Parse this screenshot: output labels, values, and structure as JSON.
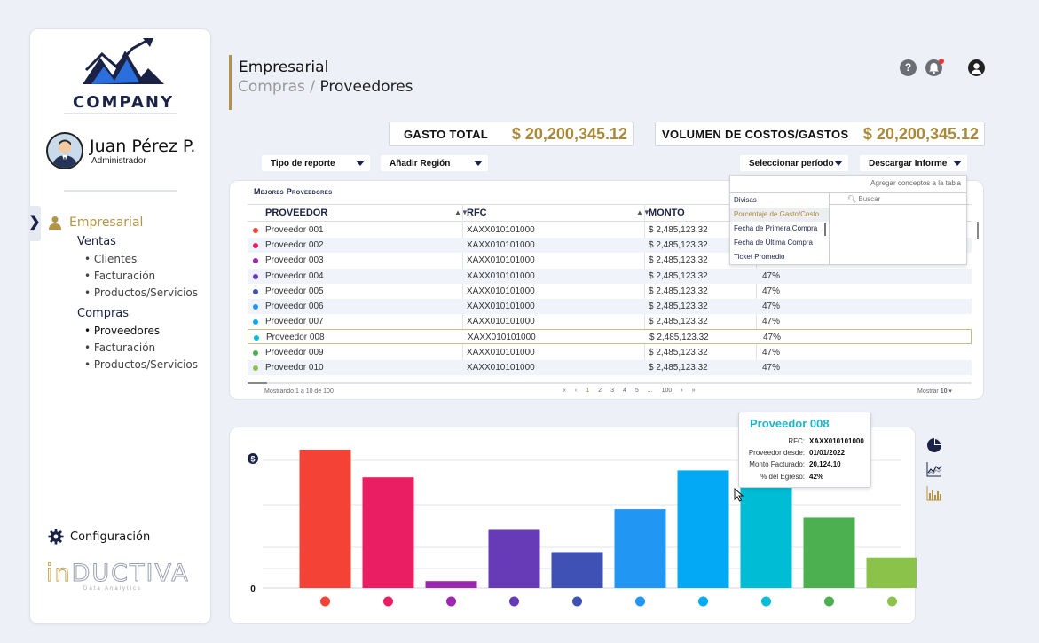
{
  "brand": {
    "company": "COMPANY",
    "footer_logo_in": "in",
    "footer_logo_rest": "DUCTIVA",
    "footer_logo_sub": "Data Analytics"
  },
  "user": {
    "name": "Juan Pérez P.",
    "role": "Administrador"
  },
  "nav": {
    "main": "Empresarial",
    "sections": [
      {
        "label": "Ventas",
        "items": [
          "Clientes",
          "Facturación",
          "Productos/Servicios"
        ]
      },
      {
        "label": "Compras",
        "items": [
          "Proveedores",
          "Facturación",
          "Productos/Servicios"
        ]
      }
    ],
    "config": "Configuración"
  },
  "header": {
    "title": "Empresarial",
    "breadcrumb_parent": "Compras",
    "breadcrumb_sep": " / ",
    "breadcrumb_current": "Proveedores",
    "help": "?"
  },
  "kpis": {
    "gasto_label": "GASTO TOTAL",
    "gasto_value": "$ 20,200,345.12",
    "volumen_label": "VOLUMEN DE COSTOS/GASTOS",
    "volumen_value": "$ 20,200,345.12"
  },
  "filters": {
    "tipo_reporte": "Tipo de reporte",
    "anadir_region": "Añadir Región",
    "seleccionar_periodo": "Seleccionar período",
    "descargar_informe": "Descargar Informe"
  },
  "table": {
    "title": "Mejores Proveedores",
    "columns": [
      "PROVEEDOR",
      "RFC",
      "MONTO"
    ],
    "rows": [
      {
        "name": "Proveedor 001",
        "rfc": "XAXX010101000",
        "monto": "$ 2,485,123.32",
        "pct": "",
        "color": "#f44336"
      },
      {
        "name": "Proveedor 002",
        "rfc": "XAXX010101000",
        "monto": "$ 2,485,123.32",
        "pct": "",
        "color": "#e91e63"
      },
      {
        "name": "Proveedor 003",
        "rfc": "XAXX010101000",
        "monto": "$ 2,485,123.32",
        "pct": "",
        "color": "#9c27b0"
      },
      {
        "name": "Proveedor 004",
        "rfc": "XAXX010101000",
        "monto": "$ 2,485,123.32",
        "pct": "47%",
        "color": "#673ab7"
      },
      {
        "name": "Proveedor 005",
        "rfc": "XAXX010101000",
        "monto": "$ 2,485,123.32",
        "pct": "47%",
        "color": "#3f51b5"
      },
      {
        "name": "Proveedor 006",
        "rfc": "XAXX010101000",
        "monto": "$ 2,485,123.32",
        "pct": "47%",
        "color": "#2196f3"
      },
      {
        "name": "Proveedor 007",
        "rfc": "XAXX010101000",
        "monto": "$ 2,485,123.32",
        "pct": "47%",
        "color": "#03a9f4"
      },
      {
        "name": "Proveedor 008",
        "rfc": "XAXX010101000",
        "monto": "$ 2,485,123.32",
        "pct": "47%",
        "color": "#00bcd4"
      },
      {
        "name": "Proveedor 009",
        "rfc": "XAXX010101000",
        "monto": "$ 2,485,123.32",
        "pct": "47%",
        "color": "#4caf50"
      },
      {
        "name": "Proveedor 010",
        "rfc": "XAXX010101000",
        "monto": "$ 2,485,123.32",
        "pct": "47%",
        "color": "#8bc34a"
      }
    ],
    "showing": "Mostrando 1 a 10 de 100",
    "pages": [
      "«",
      "‹",
      "1",
      "2",
      "3",
      "4",
      "5",
      "...",
      "100",
      "›",
      "»"
    ],
    "mostrar_label": "Mostrar",
    "mostrar_value": "10"
  },
  "concepts_popover": {
    "header": "Agregar conceptos a la tabla",
    "items": [
      "Divisas",
      "Porcentaje de Gasto/Costo",
      "Fecha de Primera Compra",
      "Fecha de Última Compra",
      "Ticket Promedio"
    ],
    "search_placeholder": "Buscar"
  },
  "chart_data": {
    "type": "bar",
    "categories": [
      "Proveedor 001",
      "Proveedor 002",
      "Proveedor 003",
      "Proveedor 004",
      "Proveedor 005",
      "Proveedor 006",
      "Proveedor 007",
      "Proveedor 008",
      "Proveedor 009",
      "Proveedor 010"
    ],
    "values": [
      100,
      80,
      5,
      42,
      26,
      57,
      85,
      90,
      51,
      22
    ],
    "colors": [
      "#f44336",
      "#e91e63",
      "#9c27b0",
      "#673ab7",
      "#3f51b5",
      "#2196f3",
      "#03a9f4",
      "#00bcd4",
      "#4caf50",
      "#8bc34a"
    ],
    "ylabel": "$",
    "zero_label": "0",
    "ylim": [
      0,
      100
    ],
    "grid": true
  },
  "tooltip": {
    "title": "Proveedor 008",
    "fields": [
      {
        "label": "RFC:",
        "value": "XAXX010101000"
      },
      {
        "label": "Proveedor desde:",
        "value": "01/01/2022"
      },
      {
        "label": "Monto Facturado:",
        "value": "20,124.10"
      },
      {
        "label": "% del Egreso:",
        "value": "42%"
      }
    ]
  }
}
